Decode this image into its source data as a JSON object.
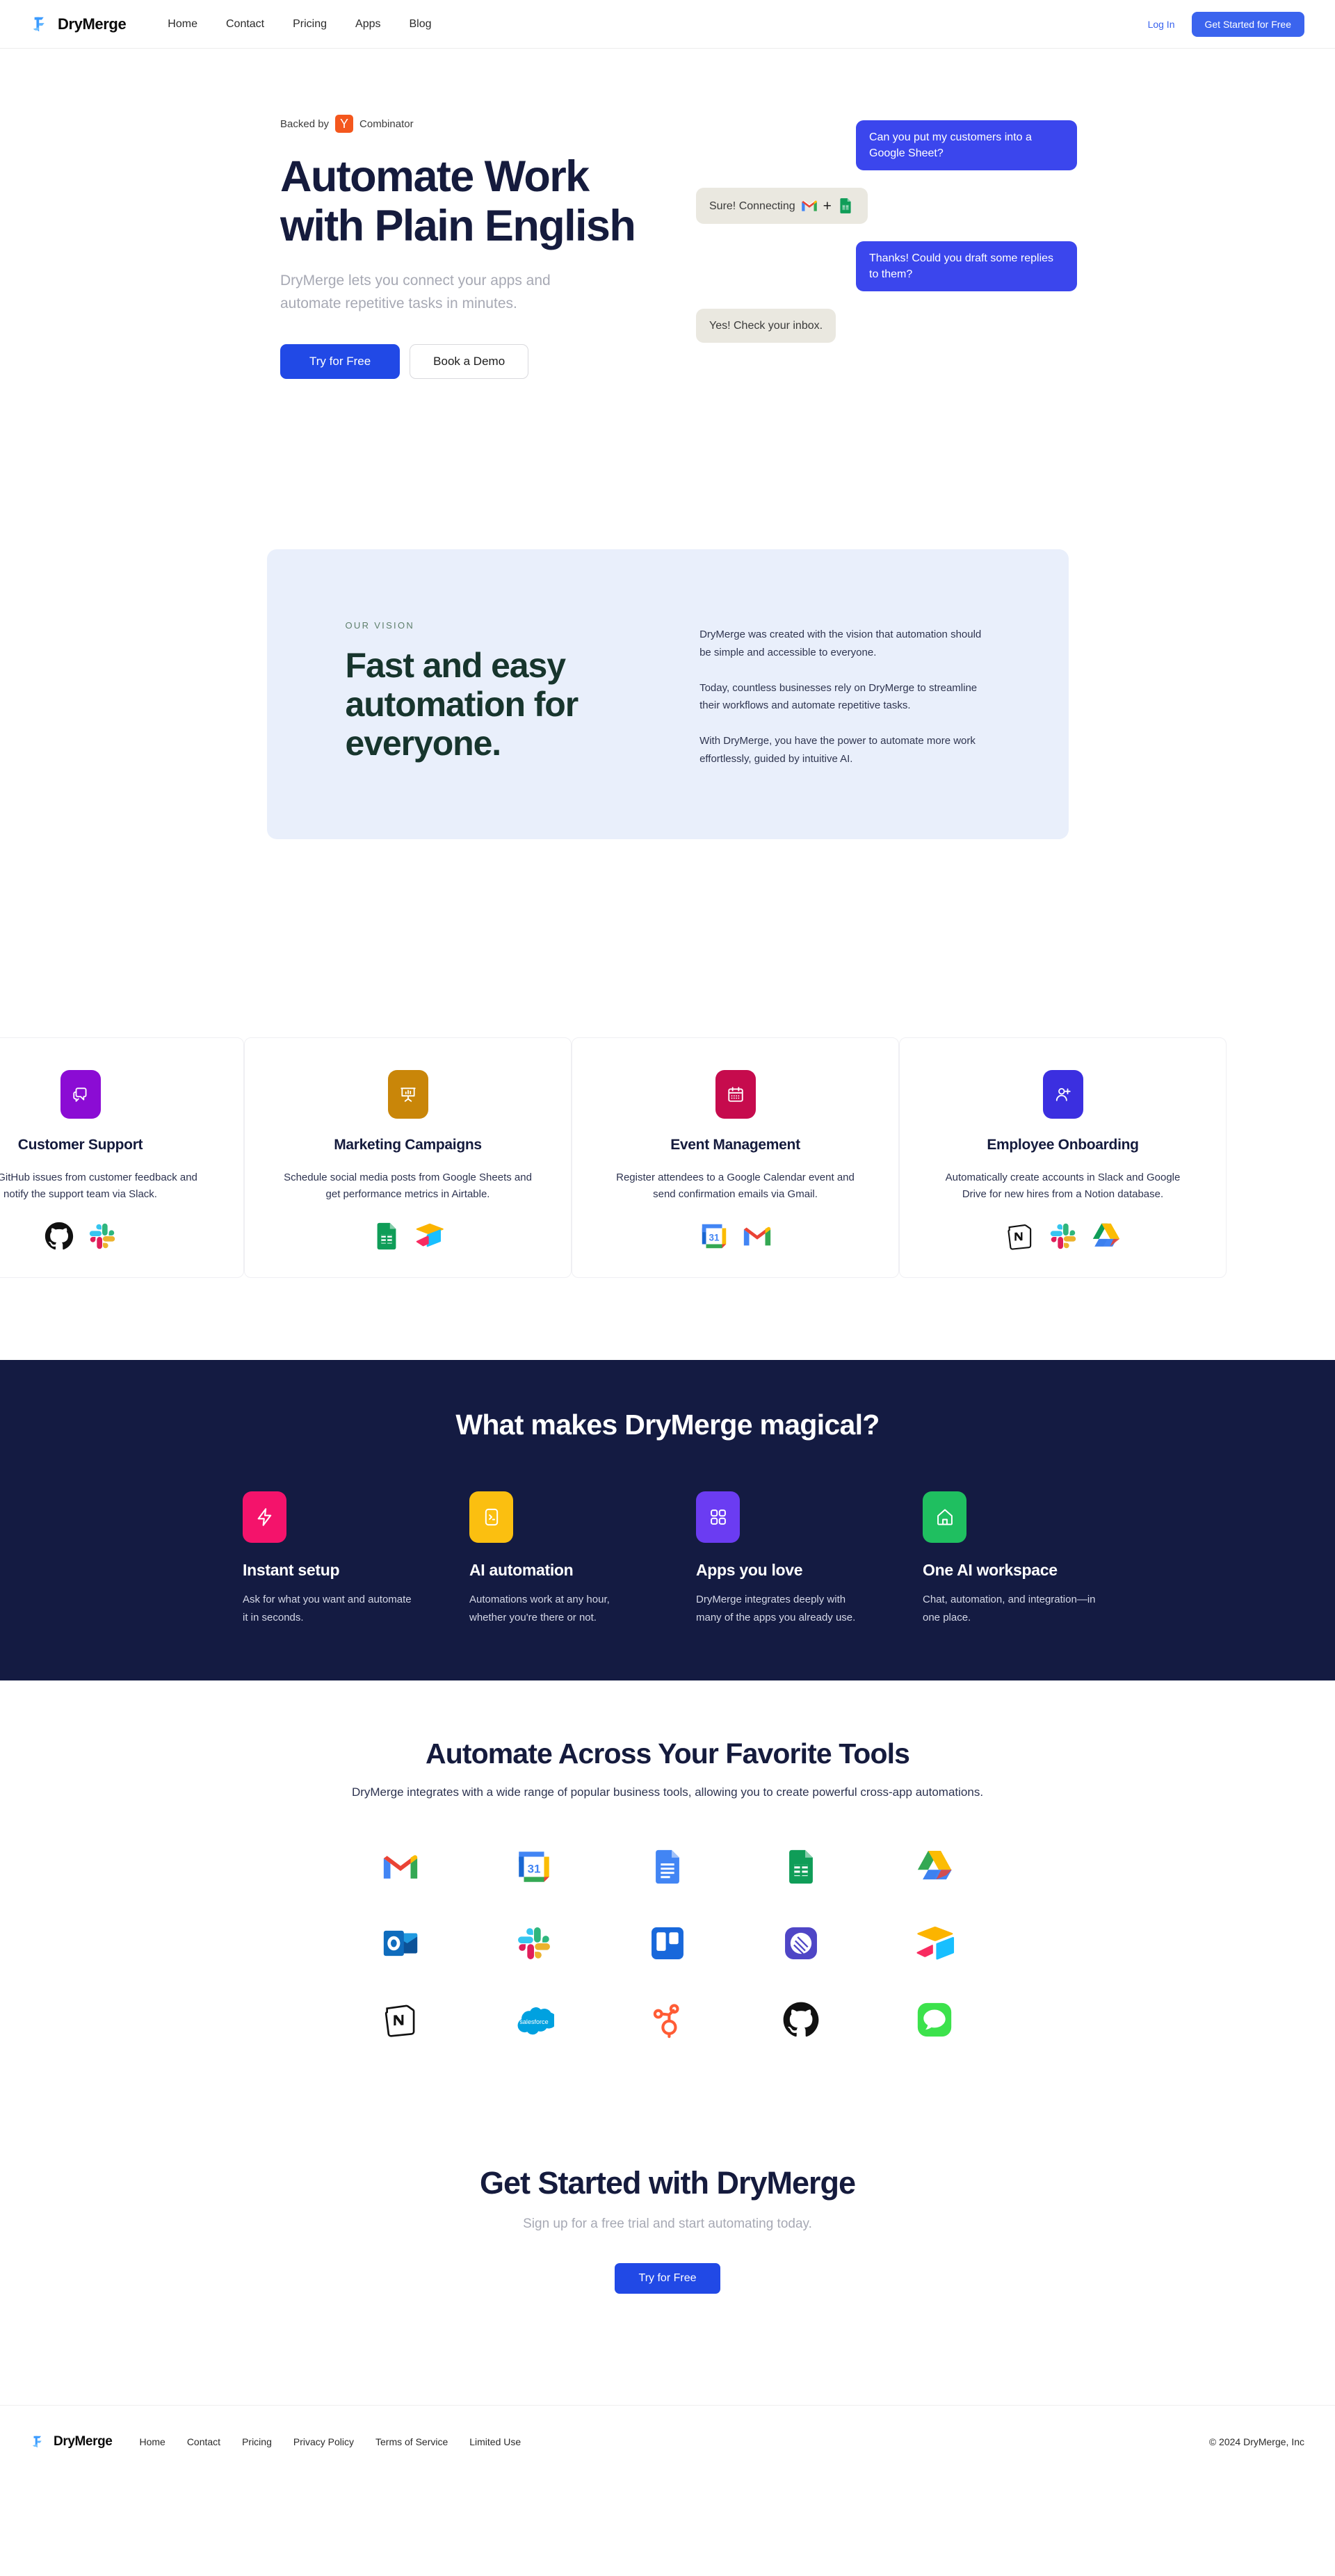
{
  "brand": {
    "name": "DryMerge",
    "logo_icon": "drymerge-logo-icon"
  },
  "header": {
    "nav": [
      {
        "label": "Home"
      },
      {
        "label": "Contact"
      },
      {
        "label": "Pricing"
      },
      {
        "label": "Apps"
      },
      {
        "label": "Blog"
      }
    ],
    "login_label": "Log In",
    "cta_label": "Get Started for Free",
    "accent_color": "#3B64EE"
  },
  "hero": {
    "backed_prefix": "Backed by",
    "yc_letter": "Y",
    "backed_suffix": "Combinator",
    "title": "Automate Work with Plain English",
    "subtitle": "DryMerge lets you connect your apps and automate repetitive tasks in minutes.",
    "primary_cta": "Try for Free",
    "secondary_cta": "Book a Demo",
    "chat": [
      {
        "side": "out",
        "text": "Can you put my customers into a Google Sheet?"
      },
      {
        "side": "in",
        "text": "Sure! Connecting",
        "icons": [
          "gmail-icon",
          "plus-icon",
          "google-sheets-icon"
        ]
      },
      {
        "side": "out",
        "text": "Thanks! Could you draft some replies to them?"
      },
      {
        "side": "in",
        "text": "Yes! Check your inbox."
      }
    ],
    "bubble_out_color": "#3B46ED",
    "bubble_in_color": "#EAE8E0"
  },
  "vision": {
    "kicker": "OUR VISION",
    "title": "Fast and easy automation for everyone.",
    "paragraphs": [
      "DryMerge was created with the vision that automation should be simple and accessible to everyone.",
      "Today, countless businesses rely on DryMerge to streamline their workflows and automate repetitive tasks.",
      "With DryMerge, you have the power to automate more work effortlessly, guided by intuitive AI."
    ],
    "background_color": "#E9EFFB",
    "title_color": "#17352D"
  },
  "use_cases": [
    {
      "title": "Customer Support",
      "desc": "Create GitHub issues from customer feedback and notify the support team via Slack.",
      "icon": "chat-bubbles-icon",
      "icon_color": "#8B0CD4",
      "logos": [
        "github-icon",
        "slack-icon"
      ]
    },
    {
      "title": "Marketing Campaigns",
      "desc": "Schedule social media posts from Google Sheets and get performance metrics in Airtable.",
      "icon": "presentation-chart-icon",
      "icon_color": "#C98609",
      "logos": [
        "google-sheets-icon",
        "airtable-icon"
      ]
    },
    {
      "title": "Event Management",
      "desc": "Register attendees to a Google Calendar event and send confirmation emails via Gmail.",
      "icon": "calendar-icon",
      "icon_color": "#C60B4D",
      "logos": [
        "google-calendar-icon",
        "gmail-icon"
      ]
    },
    {
      "title": "Employee Onboarding",
      "desc": "Automatically create accounts in Slack and Google Drive for new hires from a Notion database.",
      "icon": "add-user-icon",
      "icon_color": "#3B2FE0",
      "logos": [
        "notion-icon",
        "slack-icon",
        "google-drive-icon"
      ]
    }
  ],
  "magical": {
    "title": "What makes DryMerge magical?",
    "background_color": "#141B42",
    "features": [
      {
        "name": "Instant setup",
        "desc": "Ask for what you want and automate it in seconds.",
        "icon": "lightning-bolt-icon",
        "icon_color": "#F4136B"
      },
      {
        "name": "AI automation",
        "desc": "Automations work at any hour, whether you're there or not.",
        "icon": "terminal-icon",
        "icon_color": "#FBBF10"
      },
      {
        "name": "Apps you love",
        "desc": "DryMerge integrates deeply with many of the apps you already use.",
        "icon": "grid-apps-icon",
        "icon_color": "#6B3CF2"
      },
      {
        "name": "One AI workspace",
        "desc": "Chat, automation, and integration—in one place.",
        "icon": "home-icon",
        "icon_color": "#1FBF60"
      }
    ]
  },
  "integrations": {
    "title": "Automate Across Your Favorite Tools",
    "subtitle": "DryMerge integrates with a wide range of popular business tools, allowing you to create powerful cross-app automations.",
    "logos": [
      "gmail-icon",
      "google-calendar-icon",
      "google-docs-icon",
      "google-sheets-icon",
      "google-drive-icon",
      "outlook-icon",
      "slack-icon",
      "trello-icon",
      "linear-icon",
      "airtable-icon",
      "notion-icon",
      "salesforce-icon",
      "hubspot-icon",
      "github-icon",
      "imessage-icon"
    ]
  },
  "cta": {
    "title": "Get Started with DryMerge",
    "subtitle": "Sign up for a free trial and start automating today.",
    "button_label": "Try for Free"
  },
  "footer": {
    "nav": [
      {
        "label": "Home"
      },
      {
        "label": "Contact"
      },
      {
        "label": "Pricing"
      },
      {
        "label": "Privacy Policy"
      },
      {
        "label": "Terms of Service"
      },
      {
        "label": "Limited Use"
      }
    ],
    "copyright": "© 2024 DryMerge, Inc"
  }
}
